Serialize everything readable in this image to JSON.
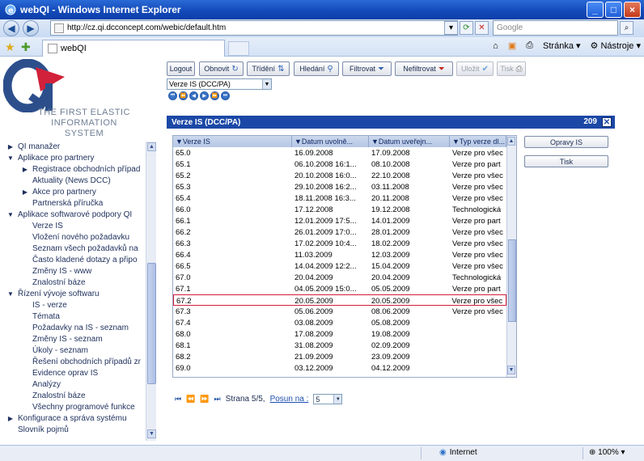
{
  "window": {
    "title": "webQI - Windows Internet Explorer",
    "controls": [
      "_",
      "□",
      "×"
    ]
  },
  "browser": {
    "url": "http://cz.qi.dcconcept.com/webic/default.htm",
    "search_placeholder": "Google",
    "tab_title": "webQI",
    "commands": {
      "page": "Stránka",
      "tools": "Nástroje"
    }
  },
  "logo": {
    "line1": "THE FIRST ELASTIC",
    "line2": "INFORMATION SYSTEM"
  },
  "toolbar": {
    "logout": "Logout",
    "refresh": "Obnovit",
    "sort": "Třídění",
    "search": "Hledání",
    "filter": "Filtrovat",
    "unfilter": "Nefiltrovat",
    "save": "Uložit",
    "print": "Tisk"
  },
  "view_select": "Verze IS (DCC/PA)",
  "sidebar": {
    "items": [
      {
        "label": "QI manažer",
        "level": 0,
        "marker": "▶"
      },
      {
        "label": "Aplikace pro partnery",
        "level": 0,
        "marker": "▼"
      },
      {
        "label": "Registrace obchodních případ",
        "level": 1,
        "marker": "▶"
      },
      {
        "label": "Aktuality (News DCC)",
        "level": 1,
        "marker": ""
      },
      {
        "label": "Akce pro partnery",
        "level": 1,
        "marker": "▶"
      },
      {
        "label": "Partnerská příručka",
        "level": 1,
        "marker": ""
      },
      {
        "label": "Aplikace softwarové podpory QI",
        "level": 0,
        "marker": "▼"
      },
      {
        "label": "Verze IS",
        "level": 1,
        "marker": ""
      },
      {
        "label": "Vložení nového požadavku",
        "level": 1,
        "marker": ""
      },
      {
        "label": "Seznam všech požadavků na",
        "level": 1,
        "marker": ""
      },
      {
        "label": "Často kladené dotazy a připo",
        "level": 1,
        "marker": ""
      },
      {
        "label": "Změny IS - www",
        "level": 1,
        "marker": ""
      },
      {
        "label": "Znalostní báze",
        "level": 1,
        "marker": ""
      },
      {
        "label": "Řízení vývoje softwaru",
        "level": 0,
        "marker": "▼"
      },
      {
        "label": "IS - verze",
        "level": 1,
        "marker": ""
      },
      {
        "label": "Témata",
        "level": 1,
        "marker": ""
      },
      {
        "label": "Požadavky na IS - seznam",
        "level": 1,
        "marker": ""
      },
      {
        "label": "Změny IS - seznam",
        "level": 1,
        "marker": ""
      },
      {
        "label": "Úkoly - seznam",
        "level": 1,
        "marker": ""
      },
      {
        "label": "Řešení obchodních případů zr",
        "level": 1,
        "marker": ""
      },
      {
        "label": "Evidence oprav IS",
        "level": 1,
        "marker": ""
      },
      {
        "label": "Analýzy",
        "level": 1,
        "marker": ""
      },
      {
        "label": "Znalostní báze",
        "level": 1,
        "marker": ""
      },
      {
        "label": "Všechny programové funkce",
        "level": 1,
        "marker": ""
      },
      {
        "label": "Konfigurace a správa systému",
        "level": 0,
        "marker": "▶"
      },
      {
        "label": "Slovník pojmů",
        "level": 0,
        "marker": ""
      }
    ]
  },
  "panel": {
    "title": "Verze IS (DCC/PA)",
    "count": "209",
    "columns": [
      "Verze IS",
      "Datum uvolně...",
      "Datum uveřejn...",
      "Typ verze dl..."
    ],
    "rows": [
      [
        "65.0",
        "16.09.2008",
        "17.09.2008",
        "Verze pro všec"
      ],
      [
        "65.1",
        "06.10.2008 16:1...",
        "08.10.2008",
        "Verze pro part"
      ],
      [
        "65.2",
        "20.10.2008 16:0...",
        "22.10.2008",
        "Verze pro všec"
      ],
      [
        "65.3",
        "29.10.2008 16:2...",
        "03.11.2008",
        "Verze pro všec"
      ],
      [
        "65.4",
        "18.11.2008 16:3...",
        "20.11.2008",
        "Verze pro všec"
      ],
      [
        "66.0",
        "17.12.2008",
        "19.12.2008",
        "Technologická"
      ],
      [
        "66.1",
        "12.01.2009 17:5...",
        "14.01.2009",
        "Verze pro part"
      ],
      [
        "66.2",
        "26.01.2009 17:0...",
        "28.01.2009",
        "Verze pro všec"
      ],
      [
        "66.3",
        "17.02.2009 10:4...",
        "18.02.2009",
        "Verze pro všec"
      ],
      [
        "66.4",
        "11.03.2009",
        "12.03.2009",
        "Verze pro všec"
      ],
      [
        "66.5",
        "14.04.2009 12:2...",
        "15.04.2009",
        "Verze pro všec"
      ],
      [
        "67.0",
        "20.04.2009",
        "20.04.2009",
        "Technologická"
      ],
      [
        "67.1",
        "04.05.2009 15:0...",
        "05.05.2009",
        "Verze pro part"
      ],
      [
        "67.2",
        "20.05.2009",
        "20.05.2009",
        "Verze pro všec"
      ],
      [
        "67.3",
        "05.06.2009",
        "08.06.2009",
        "Verze pro všec"
      ],
      [
        "67.4",
        "03.08.2009",
        "05.08.2009",
        ""
      ],
      [
        "68.0",
        "17.08.2009",
        "19.08.2009",
        ""
      ],
      [
        "68.1",
        "31.08.2009",
        "02.09.2009",
        ""
      ],
      [
        "68.2",
        "21.09.2009",
        "23.09.2009",
        ""
      ],
      [
        "69.0",
        "03.12.2009",
        "04.12.2009",
        ""
      ]
    ],
    "selected_row": "67.2",
    "side_buttons": {
      "fixes": "Opravy IS",
      "print": "Tisk"
    }
  },
  "pager": {
    "page_text": "Strana 5/5,",
    "goto_link": "Posun na :",
    "page_value": "5"
  },
  "statusbar": {
    "zone": "Internet",
    "zoom": "100%"
  }
}
